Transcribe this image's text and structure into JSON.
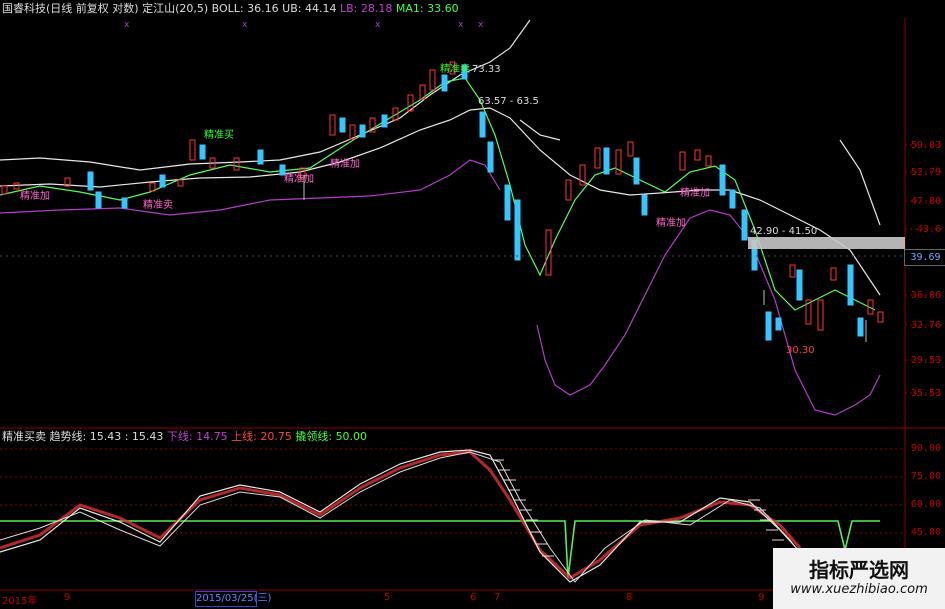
{
  "header_top": {
    "stock": "国睿科技(日线 前复权 对数)",
    "indicator": "定江山(20,5)",
    "boll_label": "BOLL:",
    "boll_value": "36.16",
    "ub_label": "UB:",
    "ub_value": "44.14",
    "lb_label": "LB:",
    "lb_value": "28.18",
    "ma1_label": "MA1:",
    "ma1_value": "33.60"
  },
  "header_bottom": {
    "name": "精准买卖",
    "trend_label": "趋势线:",
    "trend_value": "15.43 : 15.43",
    "lower_label": "下线:",
    "lower_value": "14.75",
    "upper_label": "上线:",
    "upper_value": "20.75",
    "lead_label": "撬领线:",
    "lead_value": "50.00"
  },
  "price_axis": [
    "59.03",
    "52.79",
    "47.80",
    "43.6",
    "39.69",
    "36.06",
    "32.76",
    "29.53",
    "35.53"
  ],
  "osc_axis": [
    "90.00",
    "75.00",
    "60.00",
    "45.00"
  ],
  "current_price_tag": "39.69",
  "annotations": {
    "high_value": "73.33",
    "range1": "63.57 - 63.5",
    "range2": "42.90 - 41.50",
    "low_value": "30.30",
    "sig_add1": "精准加",
    "sig_sell1": "精准卖",
    "sig_buy1": "精准买",
    "sig_add2": "精准加",
    "sig_add3": "精准加",
    "sig_top": "精准卖",
    "sig_add4": "精准加",
    "sig_add5": "精准加"
  },
  "time_axis": {
    "start": "2015年",
    "cursor_date": "2015/03/25(三)",
    "ticks": [
      "9",
      "5",
      "6",
      "7",
      "8",
      "9"
    ]
  },
  "watermark": {
    "title": "指标严选网",
    "url": "www.xuezhibiao.com"
  },
  "colors": {
    "bg": "#000000",
    "up_candle": "#ff3333",
    "down_candle": "#33c6ff",
    "ma_line": "#66ff66",
    "boll_upper": "#e8e8e8",
    "boll_lower": "#b43cc8",
    "grid": "#8b0000",
    "signal_green": "#33ff33",
    "signal_pink": "#ff66cc"
  }
}
